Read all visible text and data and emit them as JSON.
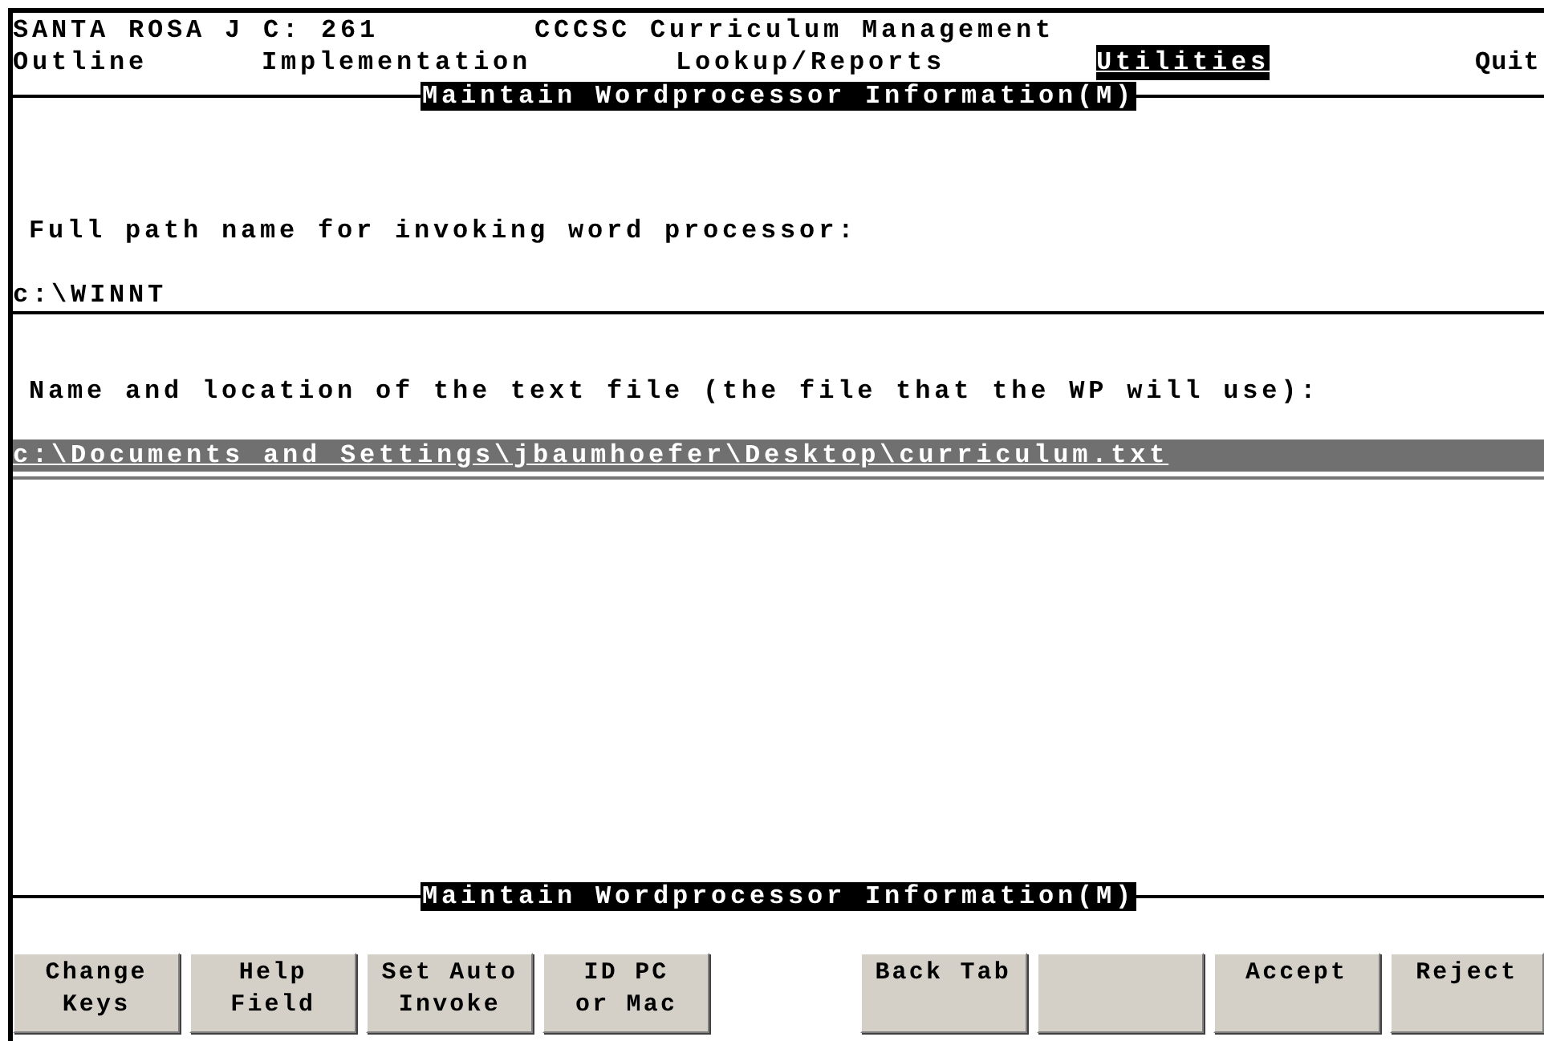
{
  "header": {
    "site": "SANTA ROSA J C: 261",
    "title": "CCCSC Curriculum Management"
  },
  "menu": [
    {
      "label": "Outline",
      "selected": false
    },
    {
      "label": "Implementation",
      "selected": false
    },
    {
      "label": "Lookup/Reports",
      "selected": false
    },
    {
      "label": "Utilities",
      "selected": true
    },
    {
      "label": "Quit",
      "selected": false
    }
  ],
  "section_title": "Maintain Wordprocessor Information(M)",
  "fields": [
    {
      "label": "Full path name for invoking word processor:",
      "value": "c:\\WINNT",
      "focused": false
    },
    {
      "label": "Name and location of the text file (the file that the WP will use):",
      "value": "c:\\Documents and Settings\\jbaumhoefer\\Desktop\\curriculum.txt",
      "focused": true
    }
  ],
  "footer_title": "Maintain Wordprocessor Information(M)",
  "keys": [
    {
      "kind": "key",
      "lines": [
        "Change",
        "Keys"
      ]
    },
    {
      "kind": "key",
      "lines": [
        "Help",
        "Field"
      ]
    },
    {
      "kind": "key",
      "lines": [
        "Set Auto",
        "Invoke"
      ]
    },
    {
      "kind": "key",
      "lines": [
        "ID PC",
        "or Mac"
      ]
    },
    {
      "kind": "gap"
    },
    {
      "kind": "key",
      "lines": [
        "Back Tab"
      ]
    },
    {
      "kind": "blank"
    },
    {
      "kind": "key",
      "lines": [
        "Accept"
      ]
    },
    {
      "kind": "key",
      "lines": [
        "Reject"
      ]
    }
  ]
}
